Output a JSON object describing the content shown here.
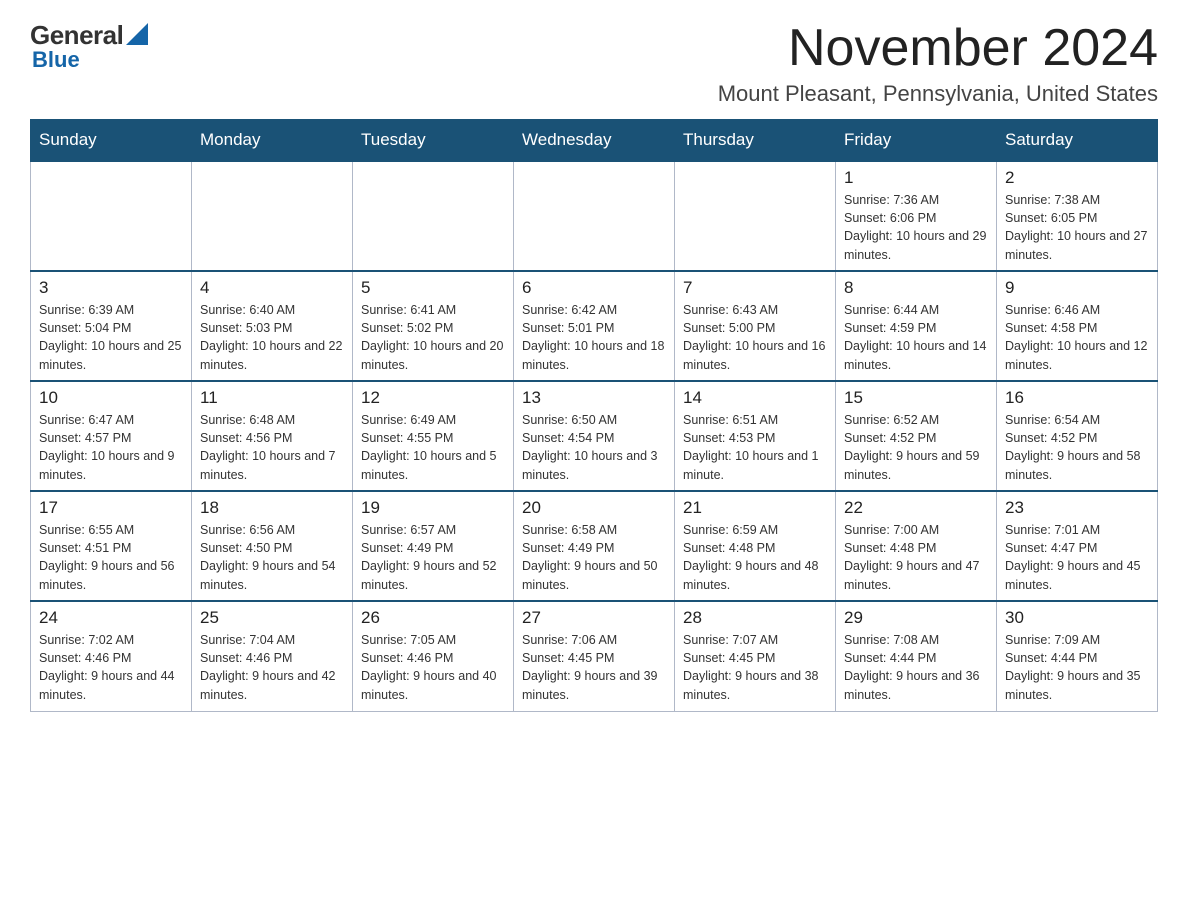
{
  "logo": {
    "general": "General",
    "blue": "Blue"
  },
  "title": "November 2024",
  "subtitle": "Mount Pleasant, Pennsylvania, United States",
  "days_of_week": [
    "Sunday",
    "Monday",
    "Tuesday",
    "Wednesday",
    "Thursday",
    "Friday",
    "Saturday"
  ],
  "weeks": [
    [
      {
        "day": "",
        "info": ""
      },
      {
        "day": "",
        "info": ""
      },
      {
        "day": "",
        "info": ""
      },
      {
        "day": "",
        "info": ""
      },
      {
        "day": "",
        "info": ""
      },
      {
        "day": "1",
        "info": "Sunrise: 7:36 AM\nSunset: 6:06 PM\nDaylight: 10 hours and 29 minutes."
      },
      {
        "day": "2",
        "info": "Sunrise: 7:38 AM\nSunset: 6:05 PM\nDaylight: 10 hours and 27 minutes."
      }
    ],
    [
      {
        "day": "3",
        "info": "Sunrise: 6:39 AM\nSunset: 5:04 PM\nDaylight: 10 hours and 25 minutes."
      },
      {
        "day": "4",
        "info": "Sunrise: 6:40 AM\nSunset: 5:03 PM\nDaylight: 10 hours and 22 minutes."
      },
      {
        "day": "5",
        "info": "Sunrise: 6:41 AM\nSunset: 5:02 PM\nDaylight: 10 hours and 20 minutes."
      },
      {
        "day": "6",
        "info": "Sunrise: 6:42 AM\nSunset: 5:01 PM\nDaylight: 10 hours and 18 minutes."
      },
      {
        "day": "7",
        "info": "Sunrise: 6:43 AM\nSunset: 5:00 PM\nDaylight: 10 hours and 16 minutes."
      },
      {
        "day": "8",
        "info": "Sunrise: 6:44 AM\nSunset: 4:59 PM\nDaylight: 10 hours and 14 minutes."
      },
      {
        "day": "9",
        "info": "Sunrise: 6:46 AM\nSunset: 4:58 PM\nDaylight: 10 hours and 12 minutes."
      }
    ],
    [
      {
        "day": "10",
        "info": "Sunrise: 6:47 AM\nSunset: 4:57 PM\nDaylight: 10 hours and 9 minutes."
      },
      {
        "day": "11",
        "info": "Sunrise: 6:48 AM\nSunset: 4:56 PM\nDaylight: 10 hours and 7 minutes."
      },
      {
        "day": "12",
        "info": "Sunrise: 6:49 AM\nSunset: 4:55 PM\nDaylight: 10 hours and 5 minutes."
      },
      {
        "day": "13",
        "info": "Sunrise: 6:50 AM\nSunset: 4:54 PM\nDaylight: 10 hours and 3 minutes."
      },
      {
        "day": "14",
        "info": "Sunrise: 6:51 AM\nSunset: 4:53 PM\nDaylight: 10 hours and 1 minute."
      },
      {
        "day": "15",
        "info": "Sunrise: 6:52 AM\nSunset: 4:52 PM\nDaylight: 9 hours and 59 minutes."
      },
      {
        "day": "16",
        "info": "Sunrise: 6:54 AM\nSunset: 4:52 PM\nDaylight: 9 hours and 58 minutes."
      }
    ],
    [
      {
        "day": "17",
        "info": "Sunrise: 6:55 AM\nSunset: 4:51 PM\nDaylight: 9 hours and 56 minutes."
      },
      {
        "day": "18",
        "info": "Sunrise: 6:56 AM\nSunset: 4:50 PM\nDaylight: 9 hours and 54 minutes."
      },
      {
        "day": "19",
        "info": "Sunrise: 6:57 AM\nSunset: 4:49 PM\nDaylight: 9 hours and 52 minutes."
      },
      {
        "day": "20",
        "info": "Sunrise: 6:58 AM\nSunset: 4:49 PM\nDaylight: 9 hours and 50 minutes."
      },
      {
        "day": "21",
        "info": "Sunrise: 6:59 AM\nSunset: 4:48 PM\nDaylight: 9 hours and 48 minutes."
      },
      {
        "day": "22",
        "info": "Sunrise: 7:00 AM\nSunset: 4:48 PM\nDaylight: 9 hours and 47 minutes."
      },
      {
        "day": "23",
        "info": "Sunrise: 7:01 AM\nSunset: 4:47 PM\nDaylight: 9 hours and 45 minutes."
      }
    ],
    [
      {
        "day": "24",
        "info": "Sunrise: 7:02 AM\nSunset: 4:46 PM\nDaylight: 9 hours and 44 minutes."
      },
      {
        "day": "25",
        "info": "Sunrise: 7:04 AM\nSunset: 4:46 PM\nDaylight: 9 hours and 42 minutes."
      },
      {
        "day": "26",
        "info": "Sunrise: 7:05 AM\nSunset: 4:46 PM\nDaylight: 9 hours and 40 minutes."
      },
      {
        "day": "27",
        "info": "Sunrise: 7:06 AM\nSunset: 4:45 PM\nDaylight: 9 hours and 39 minutes."
      },
      {
        "day": "28",
        "info": "Sunrise: 7:07 AM\nSunset: 4:45 PM\nDaylight: 9 hours and 38 minutes."
      },
      {
        "day": "29",
        "info": "Sunrise: 7:08 AM\nSunset: 4:44 PM\nDaylight: 9 hours and 36 minutes."
      },
      {
        "day": "30",
        "info": "Sunrise: 7:09 AM\nSunset: 4:44 PM\nDaylight: 9 hours and 35 minutes."
      }
    ]
  ]
}
